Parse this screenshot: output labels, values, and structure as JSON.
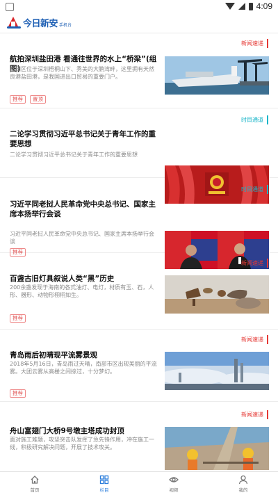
{
  "status": {
    "time": "4:09"
  },
  "header": {
    "logo_title": "今日新安",
    "logo_sub": "手机台"
  },
  "feed": [
    {
      "corner_tag": "新闻速递",
      "corner_color": "#e53935",
      "title": "航拍深圳盐田港 看通往世界的水上“桥梁”(组图)",
      "summary": "盐田区位于深圳梧桐山下、秀美的大鹏湾畔，这里拥有天然良港盐田港，是我国进出口贸易的重要门户。",
      "chips": [
        "推荐",
        "置顶"
      ],
      "image": "cargo-ship-port"
    },
    {
      "corner_tag": "时目通道",
      "corner_color": "#19b5c9",
      "title": "二论学习贯彻习近平总书记关于青年工作的重要思想",
      "summary": "二论学习贯彻习近平总书记关于青年工作的重要思想",
      "chips": [],
      "image": "red-flags-emblem"
    },
    {
      "corner_tag": "时目通道",
      "corner_color": "#19b5c9",
      "title": "习近平同老挝人民革命党中央总书记、国家主席本扬举行会谈",
      "summary": "习近平同老挝人民革命党中央总书记、国家主席本扬举行会谈",
      "chips": [
        "推荐"
      ],
      "image": "leaders-meeting"
    },
    {
      "corner_tag": "新闻速递",
      "corner_color": "#e53935",
      "title": "百盏古旧灯具叙说人类“黑”历史",
      "summary": "200余盏发现于海南的各式油灯、电灯，材质有玉、石，人形、器形、动物形栩栩如生。",
      "chips": [
        "推荐"
      ],
      "image": "ancient-lamps"
    },
    {
      "corner_tag": "新闻速递",
      "corner_color": "#e53935",
      "title": "青岛雨后初晴现平流雾景观",
      "summary": "2018年5月16日，青岛雨过天晴，南部市区出现美丽的平流雾。大团云雾从高楼之间掠过，十分梦幻。",
      "chips": [
        "推荐"
      ],
      "image": "city-fog"
    },
    {
      "corner_tag": "新闻速递",
      "corner_color": "#e53935",
      "title": "舟山富翅门大桥9号墩主塔成功封顶",
      "summary": "面对施工难题，攻坚突击队发挥了急先锋作用，冲在施工一线，积极研究解决问题，开展了技术攻关。",
      "chips": [],
      "image": "bridge-workers"
    }
  ],
  "nav": [
    {
      "label": "首页",
      "icon": "home-icon",
      "active": false
    },
    {
      "label": "栏目",
      "icon": "grid-icon",
      "active": true
    },
    {
      "label": "视频",
      "icon": "eye-icon",
      "active": false
    },
    {
      "label": "我的",
      "icon": "person-icon",
      "active": false
    }
  ],
  "colors": {
    "accent": "#2a7cdb",
    "brand_blue": "#1d5fb4",
    "brand_red": "#d9262b"
  }
}
